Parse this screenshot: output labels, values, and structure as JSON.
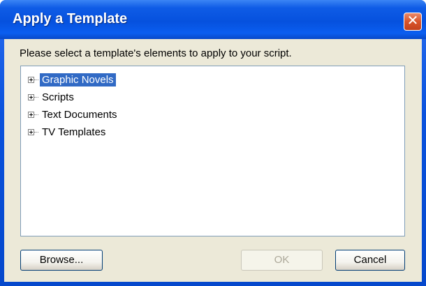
{
  "window": {
    "title": "Apply a Template",
    "close_glyph": "✕"
  },
  "dialog": {
    "prompt": "Please select a template's elements to apply to your script."
  },
  "tree": {
    "items": [
      {
        "label": "Graphic Novels",
        "selected": true
      },
      {
        "label": "Scripts",
        "selected": false
      },
      {
        "label": "Text Documents",
        "selected": false
      },
      {
        "label": "TV Templates",
        "selected": false
      }
    ]
  },
  "buttons": {
    "browse": "Browse...",
    "ok": "OK",
    "cancel": "Cancel"
  }
}
